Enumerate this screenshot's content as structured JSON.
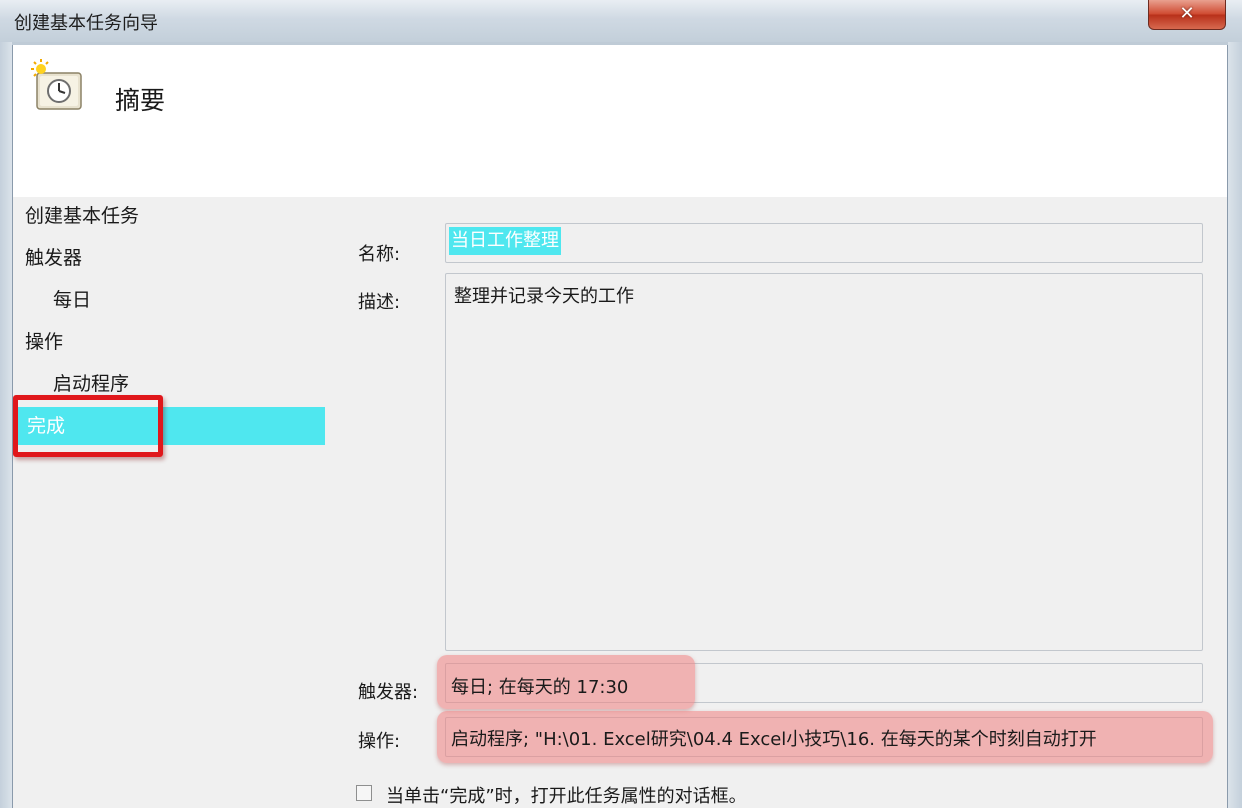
{
  "window": {
    "title": "创建基本任务向导",
    "close_glyph": "✕"
  },
  "header": {
    "title": "摘要",
    "icon": "task-scheduler-clock-icon"
  },
  "nav": {
    "items": [
      {
        "label": "创建基本任务",
        "indent": false
      },
      {
        "label": "触发器",
        "indent": false
      },
      {
        "label": "每日",
        "indent": true
      },
      {
        "label": "操作",
        "indent": false
      },
      {
        "label": "启动程序",
        "indent": true
      },
      {
        "label": "完成",
        "indent": false,
        "selected": true
      }
    ]
  },
  "summary": {
    "name_label": "名称:",
    "name_value": "当日工作整理",
    "desc_label": "描述:",
    "desc_value": "整理并记录今天的工作",
    "trigger_label": "触发器:",
    "trigger_value": "每日; 在每天的 17:30",
    "action_label": "操作:",
    "action_value": "启动程序; \"H:\\01. Excel研究\\04.4 Excel小技巧\\16. 在每天的某个时刻自动打开",
    "open_props_label": "当单击“完成”时，打开此任务属性的对话框。",
    "open_props_checked": false
  },
  "colors": {
    "selection": "#4fe7ef",
    "annotation_red": "#e0171b",
    "highlight": "#f08080"
  }
}
